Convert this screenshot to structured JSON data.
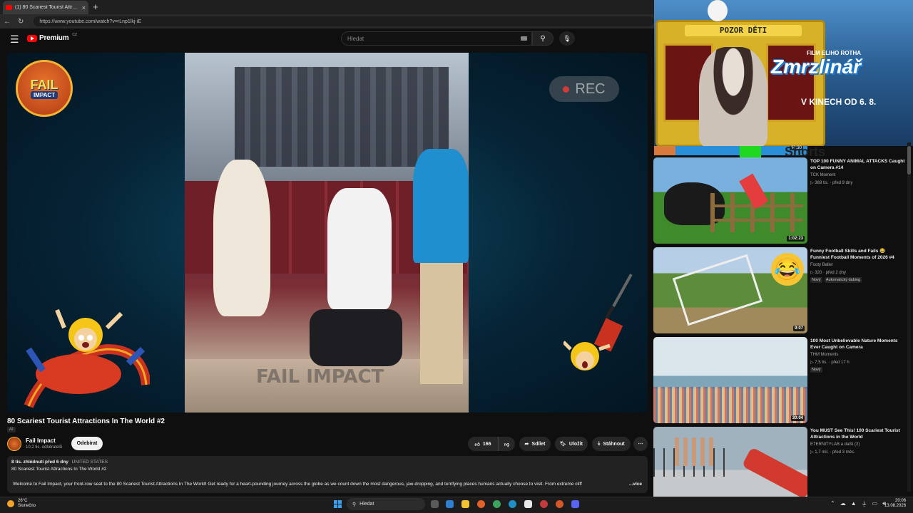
{
  "browser": {
    "tab_title": "(1) 80 Scariest Tourist Attractio",
    "tab_close": "×",
    "new_tab": "+",
    "url": "https://www.youtube.com/watch?v=rLnp1lkj-iE"
  },
  "youtube": {
    "logo_text": "Premium",
    "logo_region": "CZ",
    "search_placeholder": "Hledat"
  },
  "player": {
    "rec_label": "REC",
    "channel_badge_line1": "FAIL",
    "channel_badge_line2": "IMPACT",
    "watermark": "FAIL IMPACT"
  },
  "video": {
    "title": "80 Scariest Tourist Attractions In The World #2",
    "ai_badge": "AI",
    "channel_name": "Fail Impact",
    "subscribers": "10,2 tis. odběratelů",
    "subscribe_label": "Odebírat",
    "likes": "166",
    "share_label": "Sdílet",
    "save_label": "Uložit",
    "download_label": "Stáhnout",
    "more_label": "⋯",
    "views": "8 tis. zhlédnutí",
    "age": "před 6 dny",
    "region": "UNITED STATES",
    "desc_title": "80 Scariest Tourist Attractions In The World #2",
    "desc_text": "Welcome to Fail Impact, your front-row seat to the 80 Scariest Tourist Attractions In The World! Get ready for a heart-pounding journey across the globe as we count down the most dangerous, jaw-dropping, and terrifying places humans actually choose to visit. From extreme cliff",
    "desc_more": "...více"
  },
  "ad": {
    "sign_text": "POZOR DĚTI",
    "film_tag": "FILM ELIHO ROTHA",
    "film_title": "Zmrzlinář",
    "release": "V KINECH OD 6. 8.",
    "strip_duration": "36:30",
    "strip_text": "Shorts"
  },
  "recommendations": [
    {
      "title": "TOP 100 FUNNY ANIMAL ATTACKS Caught on Camera #14",
      "channel": "TCK Moment",
      "views": "369 tis.",
      "age": "před 9 dny",
      "duration": "1:02:23",
      "badges": []
    },
    {
      "title": "Funny Football Skills and Fails 😂 Funniest Football Moments of 2026 #4",
      "channel": "Footy Baller",
      "views": "320",
      "age": "před 2 dny",
      "duration": "9:07",
      "badges": [
        "Nový",
        "Automatický dabing"
      ]
    },
    {
      "title": "100 Most Unbelievable Nature Moments Ever Caught on Camera",
      "channel": "THM Moments",
      "views": "7,5 tis.",
      "age": "před 17 h",
      "duration": "30:04",
      "badges": [
        "Nový"
      ]
    },
    {
      "title": "You MUST See This! 100 Scariest Tourist Attractions in the World",
      "channel": "ETERNITYLAB a další (2)",
      "views": "1,7 mil.",
      "age": "před 3 měs.",
      "duration": "",
      "badges": []
    }
  ],
  "taskbar": {
    "temperature": "26°C",
    "weather": "Slunečno",
    "search_label": "Hledat",
    "time": "20:06",
    "date": "13.08.2026"
  },
  "colors": {
    "accent": "#ff0000",
    "background": "#0f0f0f",
    "surface": "#272727"
  }
}
